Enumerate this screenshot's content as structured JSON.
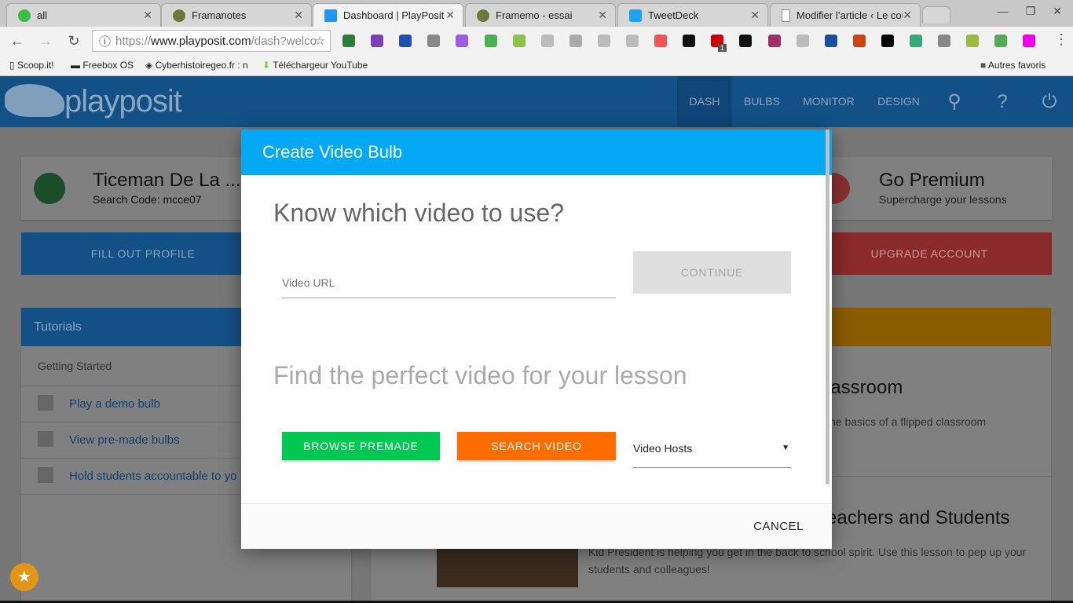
{
  "browser": {
    "tabs": [
      {
        "title": "all",
        "color": "#3dbb4a"
      },
      {
        "title": "Framanotes",
        "color": "#6b7a3a"
      },
      {
        "title": "Dashboard | PlayPosit",
        "color": "#2196f3",
        "active": true
      },
      {
        "title": "Framemo - essai",
        "color": "#6b7a3a"
      },
      {
        "title": "TweetDeck",
        "color": "#1da1f2"
      },
      {
        "title": "Modifier l’article ‹ Le cou",
        "color": "#999"
      }
    ],
    "url_scheme": "https://",
    "url_host": "www.playposit.com",
    "url_path": "/dash?welco",
    "extension_badge": "1",
    "bookmarks": [
      "Scoop.it!",
      "Freebox OS",
      "Cyberhistoiregeo.fr : n",
      "Téléchargeur YouTube"
    ],
    "other_bookmarks": "Autres favoris"
  },
  "app": {
    "logo": "playposit",
    "nav": [
      "DASH",
      "BULBS",
      "MONITOR",
      "DESIGN"
    ],
    "profile_name": "Ticeman De La ...",
    "search_code": "Search Code: mcce07",
    "premium_title": "Go Premium",
    "premium_sub": "Supercharge your lessons",
    "fill_profile": "FILL OUT PROFILE",
    "upgrade": "UPGRADE ACCOUNT",
    "tutorials_title": "Tutorials",
    "tutorials_section": "Getting Started",
    "tutorials": [
      "Play a demo bulb",
      "View pre-made bulbs",
      "Hold students accountable to yo"
    ],
    "lesson1_title": "lassroom",
    "lesson1_desc": "he basics of a flipped classroom",
    "lesson2_title": "eachers and Students",
    "lesson2_desc": "Kid President is helping you get in the back to school spirit. Use this lesson to pep up your students and colleagues!"
  },
  "modal": {
    "title": "Create Video Bulb",
    "heading1": "Know which video to use?",
    "url_placeholder": "Video URL",
    "continue": "CONTINUE",
    "heading2": "Find the perfect video for your lesson",
    "browse": "BROWSE PREMADE",
    "search": "SEARCH VIDEO",
    "hosts": "Video Hosts",
    "cancel": "CANCEL",
    "colors": {
      "header": "#03a9f4",
      "browse": "#00c853",
      "search": "#ff6d00"
    }
  }
}
